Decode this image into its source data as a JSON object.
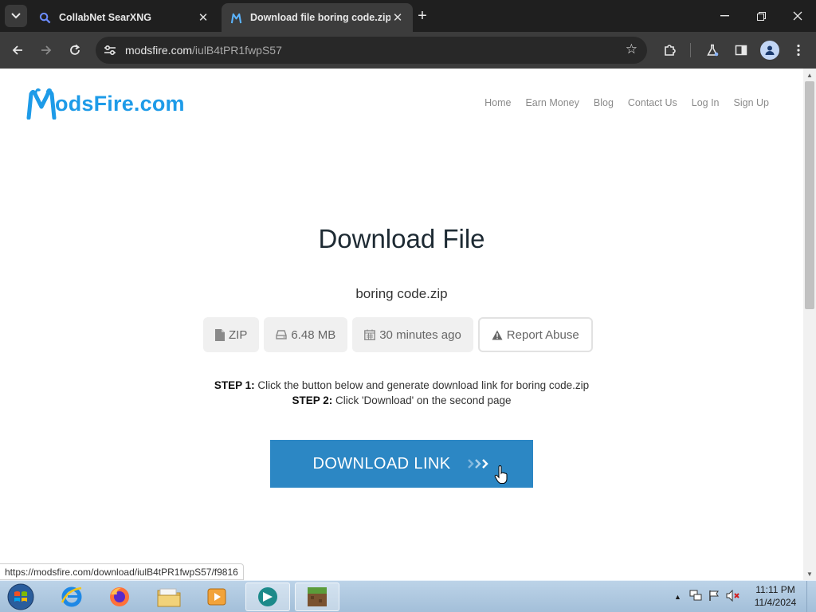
{
  "browser": {
    "tabs": [
      {
        "title": "CollabNet SearXNG",
        "icon": "search-icon",
        "active": false
      },
      {
        "title": "Download file boring code.zip",
        "icon": "modsfire-flame-icon",
        "active": true
      }
    ],
    "new_tab_label": "+",
    "url_domain": "modsfire.com",
    "url_path": "/iulB4tPR1fwpS57",
    "status_url": "https://modsfire.com/download/iulB4tPR1fwpS57/f9816"
  },
  "site": {
    "logo_text": "odsFire.com",
    "nav": [
      "Home",
      "Earn Money",
      "Blog",
      "Contact Us",
      "Log In",
      "Sign Up"
    ],
    "accent_color": "#1e9be8",
    "button_color": "#2c87c4"
  },
  "download": {
    "heading": "Download File",
    "filename": "boring code.zip",
    "chips": {
      "type": "ZIP",
      "size": "6.48 MB",
      "time": "30 minutes ago",
      "report": "Report Abuse"
    },
    "step1_label": "STEP 1:",
    "step1_text": " Click the button below and generate download link for boring code.zip",
    "step2_label": "STEP 2:",
    "step2_text": " Click 'Download' on the second page",
    "button_label": "DOWNLOAD LINK"
  },
  "taskbar": {
    "time": "11:11 PM",
    "date": "11/4/2024"
  }
}
